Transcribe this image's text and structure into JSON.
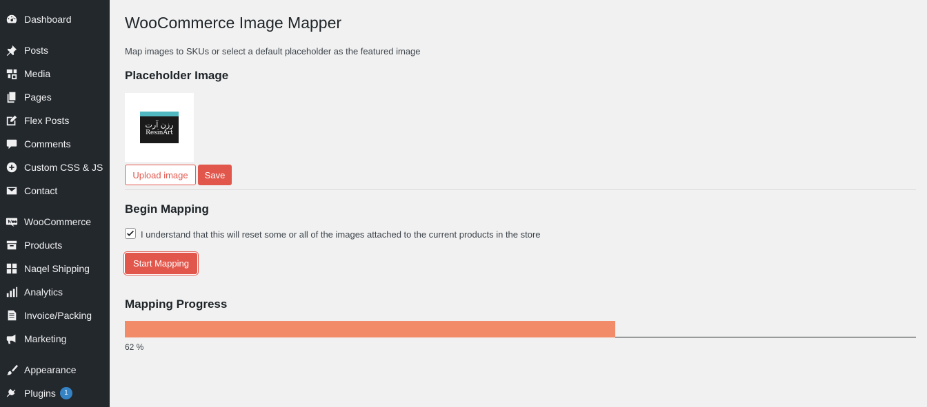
{
  "sidebar": {
    "items": [
      {
        "label": "Dashboard",
        "icon": "dashboard-icon"
      },
      {
        "label": "Posts",
        "icon": "pin-icon"
      },
      {
        "label": "Media",
        "icon": "media-icon"
      },
      {
        "label": "Pages",
        "icon": "pages-icon"
      },
      {
        "label": "Flex Posts",
        "icon": "edit-icon"
      },
      {
        "label": "Comments",
        "icon": "comment-icon"
      },
      {
        "label": "Custom CSS & JS",
        "icon": "plus-circle-icon"
      },
      {
        "label": "Contact",
        "icon": "mail-icon"
      },
      {
        "label": "WooCommerce",
        "icon": "woo-icon"
      },
      {
        "label": "Products",
        "icon": "archive-icon"
      },
      {
        "label": "Naqel Shipping",
        "icon": "grid-icon"
      },
      {
        "label": "Analytics",
        "icon": "bar-chart-icon"
      },
      {
        "label": "Invoice/Packing",
        "icon": "document-icon"
      },
      {
        "label": "Marketing",
        "icon": "megaphone-icon"
      },
      {
        "label": "Appearance",
        "icon": "brush-icon"
      },
      {
        "label": "Plugins",
        "icon": "plugin-icon",
        "badge": "1"
      }
    ]
  },
  "main": {
    "title": "WooCommerce Image Mapper",
    "subtitle": "Map images to SKUs or select a default placeholder as the featured image",
    "placeholder_heading": "Placeholder Image",
    "logo": {
      "arabic": "رزن آرت",
      "english": "ResinArt"
    },
    "upload_label": "Upload image",
    "save_label": "Save",
    "mapping_heading": "Begin Mapping",
    "confirm_checked": true,
    "confirm_label": "I understand that this will reset some or all of the images attached to the current products in the store",
    "start_label": "Start Mapping",
    "progress_heading": "Mapping Progress",
    "progress_value": 62,
    "progress_text": "62 %"
  },
  "colors": {
    "sidebar_bg": "#23282d",
    "accent": "#e2574c",
    "progress": "#f28b67",
    "badge": "#3582c4"
  }
}
